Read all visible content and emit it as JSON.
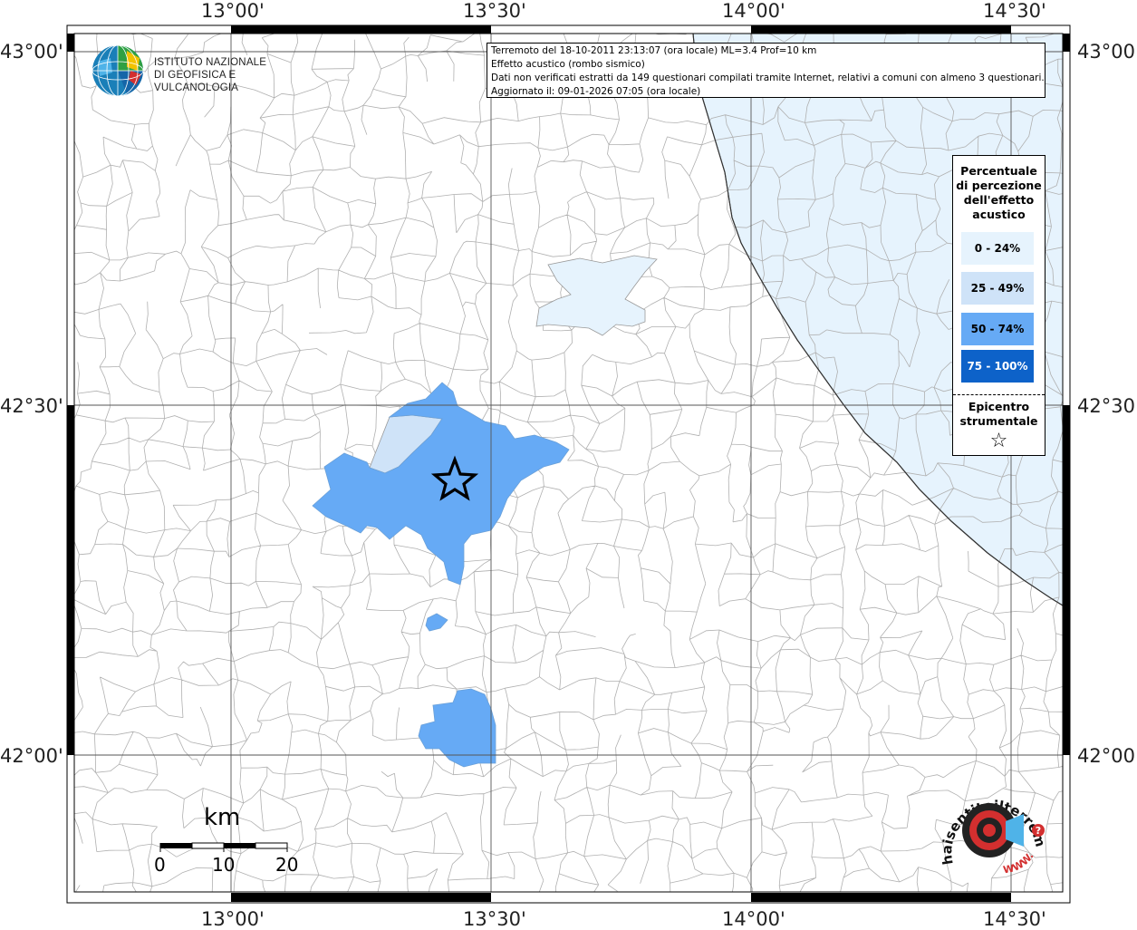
{
  "info": {
    "line1": "Terremoto del 18-10-2011 23:13:07 (ora locale) ML=3.4 Prof=10 km",
    "line2": "Effetto acustico (rombo sismico)",
    "line3": "Dati non verificati estratti da 149 questionari compilati tramite Internet, relativi a comuni con almeno 3 questionari.",
    "line4": "Aggiornato il: 09-01-2026 07:05 (ora locale)"
  },
  "ingv": {
    "line1": "ISTITUTO NAZIONALE",
    "line2": "DI GEOFISICA E VULCANOLOGIA"
  },
  "coords": {
    "lon_1300": "13°00'",
    "lon_1330": "13°30'",
    "lon_1400": "14°00'",
    "lon_1430": "14°30'",
    "lat_4300": "43°00'",
    "lat_4230": "42°30'",
    "lat_4200": "42°00'"
  },
  "legend": {
    "title_l1": "Percentuale",
    "title_l2": "di percezione",
    "title_l3": "dell'effetto",
    "title_l4": "acustico",
    "items": [
      {
        "label": "0 - 24%",
        "color": "#e6f3fd"
      },
      {
        "label": "25 - 49%",
        "color": "#cfe3f8"
      },
      {
        "label": "50 - 74%",
        "color": "#66aaf5"
      },
      {
        "label": "75 - 100%",
        "color": "#0d62c9"
      }
    ],
    "epicenter_l1": "Epicentro",
    "epicenter_l2": "strumentale",
    "star": "☆"
  },
  "scale": {
    "unit": "km",
    "ticks": [
      "0",
      "10",
      "20"
    ]
  },
  "hsit": {
    "text": "haisentitoilterremoto.it",
    "www": "WWW.",
    "question": "?"
  },
  "colors": {
    "sea": "#e6f3fd",
    "frame": "#000000",
    "grid": "#555555",
    "boundaries": "#b0b0b0"
  },
  "icons": {
    "ingv_logo": "ingv-globe-icon",
    "epicenter": "star-icon",
    "hsit_logo": "target-icon"
  }
}
